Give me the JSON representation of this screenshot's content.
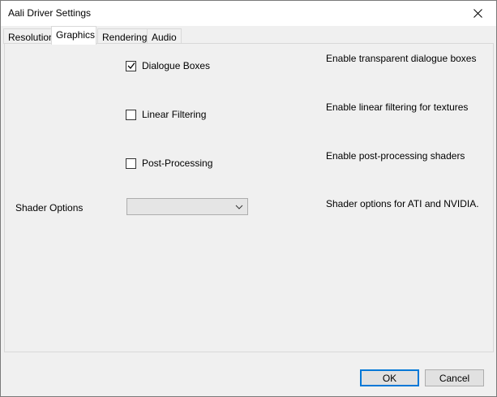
{
  "window": {
    "title": "Aali Driver Settings"
  },
  "tabs": [
    {
      "label": "Resolution",
      "active": false
    },
    {
      "label": "Graphics",
      "active": true
    },
    {
      "label": "Rendering",
      "active": false
    },
    {
      "label": "Audio",
      "active": false
    }
  ],
  "graphics": {
    "options": [
      {
        "label": "Dialogue Boxes",
        "checked": true,
        "description": "Enable transparent dialogue boxes"
      },
      {
        "label": "Linear Filtering",
        "checked": false,
        "description": "Enable linear filtering for textures"
      },
      {
        "label": "Post-Processing",
        "checked": false,
        "description": "Enable post-processing shaders"
      }
    ],
    "shader": {
      "label": "Shader Options",
      "selected": "",
      "description": "Shader options for ATI and NVIDIA."
    }
  },
  "buttons": {
    "ok": "OK",
    "cancel": "Cancel"
  },
  "icons": {
    "close": "close-icon",
    "check": "checkmark-icon",
    "dropdown": "chevron-down-icon"
  },
  "colors": {
    "accent": "#0078d7",
    "window_bg": "#f0f0f0",
    "titlebar_bg": "#ffffff"
  }
}
